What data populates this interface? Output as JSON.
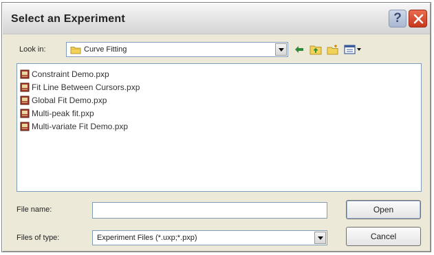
{
  "window": {
    "title": "Select an Experiment",
    "help_glyph": "?"
  },
  "lookin": {
    "label": "Look in:",
    "value": "Curve Fitting",
    "icon": "folder-icon"
  },
  "toolbar": {
    "icons": [
      "back-arrow-icon",
      "up-folder-icon",
      "new-folder-icon",
      "view-menu-icon"
    ]
  },
  "files": [
    {
      "name": "Constraint Demo.pxp",
      "icon": "experiment-file-icon"
    },
    {
      "name": "Fit Line Between Cursors.pxp",
      "icon": "experiment-file-icon"
    },
    {
      "name": "Global Fit Demo.pxp",
      "icon": "experiment-file-icon"
    },
    {
      "name": "Multi-peak fit.pxp",
      "icon": "experiment-file-icon"
    },
    {
      "name": "Multi-variate Fit Demo.pxp",
      "icon": "experiment-file-icon"
    }
  ],
  "form": {
    "filename_label": "File name:",
    "filename_value": "",
    "filetype_label": "Files of type:",
    "filetype_value": "Experiment Files (*.uxp;*.pxp)"
  },
  "buttons": {
    "open": "Open",
    "cancel": "Cancel"
  },
  "colors": {
    "dialog_bg": "#ece9d8",
    "close_red": "#c8391d",
    "folder_yellow": "#f3d25a",
    "border_blue": "#7f9db9"
  }
}
